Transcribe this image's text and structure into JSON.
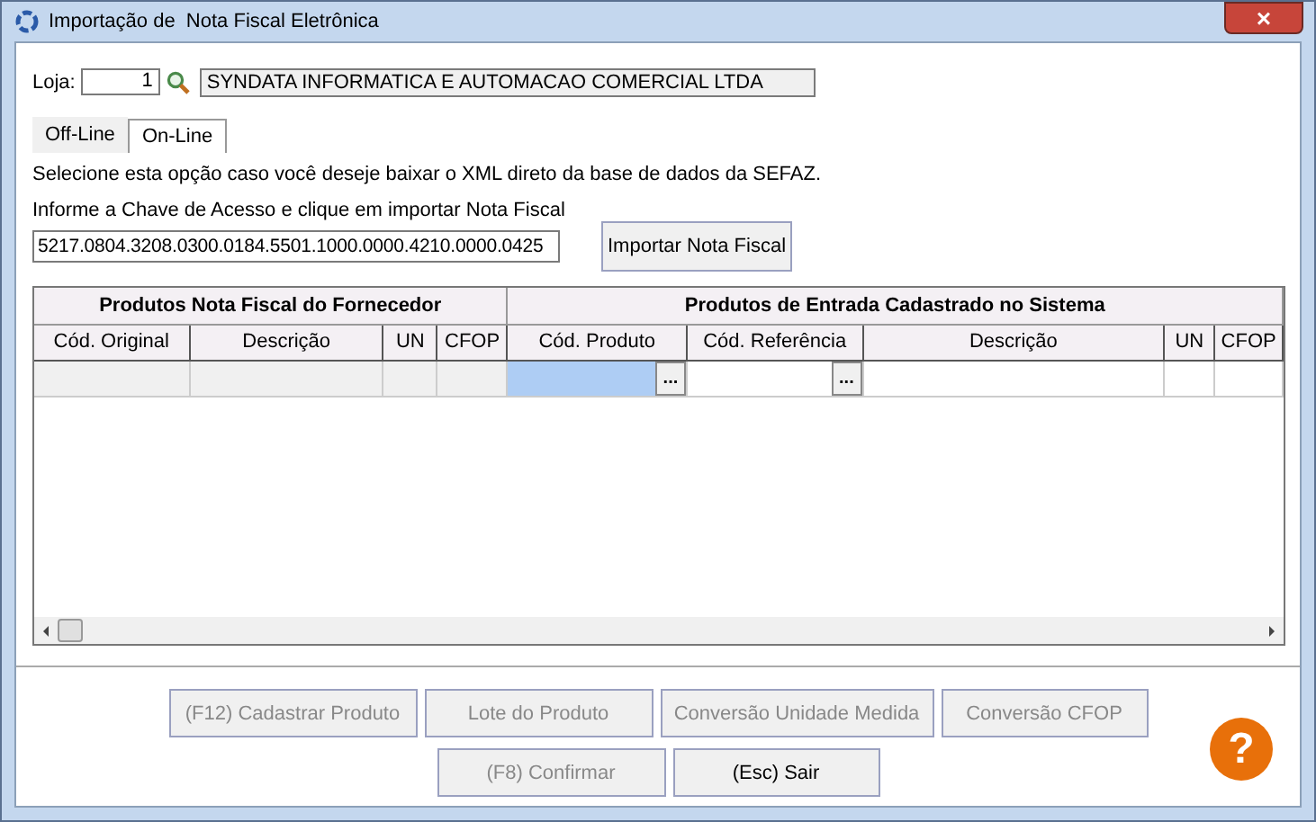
{
  "window": {
    "title": "Importação de  Nota Fiscal Eletrônica",
    "close": "×"
  },
  "store": {
    "label": "Loja:",
    "code": "1",
    "name": "SYNDATA INFORMATICA E AUTOMACAO COMERCIAL LTDA"
  },
  "tabs": [
    {
      "label": "Off-Line",
      "selected": false
    },
    {
      "label": "On-Line",
      "selected": true
    }
  ],
  "description": "Selecione esta opção caso você deseje baixar o XML direto da base de dados da SEFAZ.",
  "access_key": {
    "label": "Informe a Chave de Acesso e clique em importar Nota Fiscal",
    "value": "5217.0804.3208.0300.0184.5501.1000.0000.4210.0000.0425",
    "button": "Importar Nota Fiscal"
  },
  "table": {
    "groups": [
      "Produtos Nota Fiscal do Fornecedor",
      "Produtos de Entrada Cadastrado no Sistema"
    ],
    "columns": [
      "Cód. Original",
      "Descrição",
      "UN",
      "CFOP",
      "Cód. Produto",
      "Cód. Referência",
      "Descrição",
      "UN",
      "CFOP"
    ],
    "rows": [
      {
        "cells": [
          {
            "readonly": true,
            "focused": false
          },
          {
            "readonly": true,
            "focused": false
          },
          {
            "readonly": true,
            "focused": false
          },
          {
            "readonly": true,
            "focused": false
          },
          {
            "readonly": false,
            "focused": true,
            "button": "..."
          },
          {
            "readonly": false,
            "focused": false,
            "button": "..."
          },
          {
            "readonly": false,
            "focused": false
          },
          {
            "readonly": false,
            "focused": false
          },
          {
            "readonly": false,
            "focused": false
          }
        ]
      }
    ]
  },
  "buttons": [
    [
      {
        "label": "(F12) Cadastrar Produto",
        "disabled": true
      },
      {
        "label": "Lote do Produto",
        "disabled": true
      },
      {
        "label": "Conversão Unidade Medida",
        "disabled": true
      },
      {
        "label": "Conversão CFOP",
        "disabled": true
      }
    ],
    [
      {
        "label": "(F8) Confirmar",
        "disabled": true
      },
      {
        "label": "(Esc) Sair",
        "disabled": false
      }
    ]
  ],
  "help": "?"
}
